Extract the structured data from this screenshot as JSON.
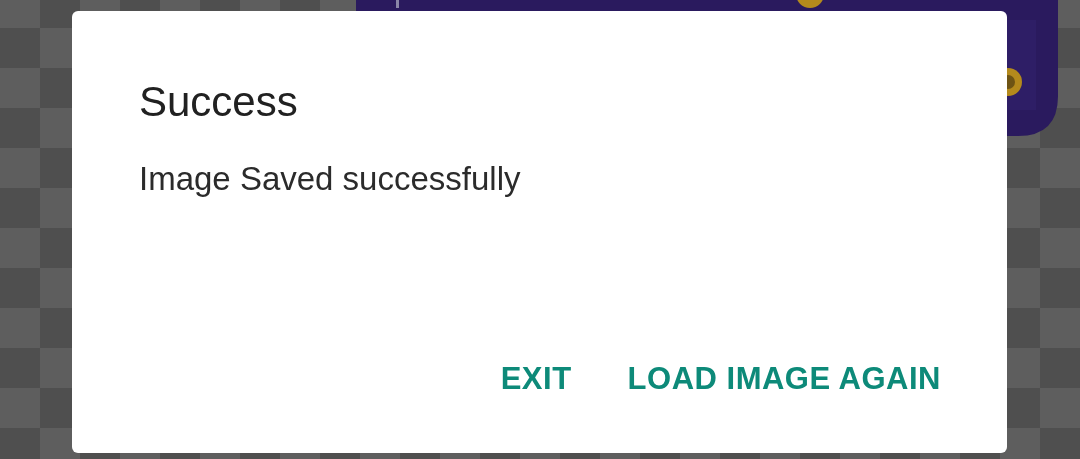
{
  "dialog": {
    "title": "Success",
    "message": "Image Saved successfully",
    "buttons": [
      "EXIT",
      "LOAD IMAGE AGAIN"
    ]
  }
}
